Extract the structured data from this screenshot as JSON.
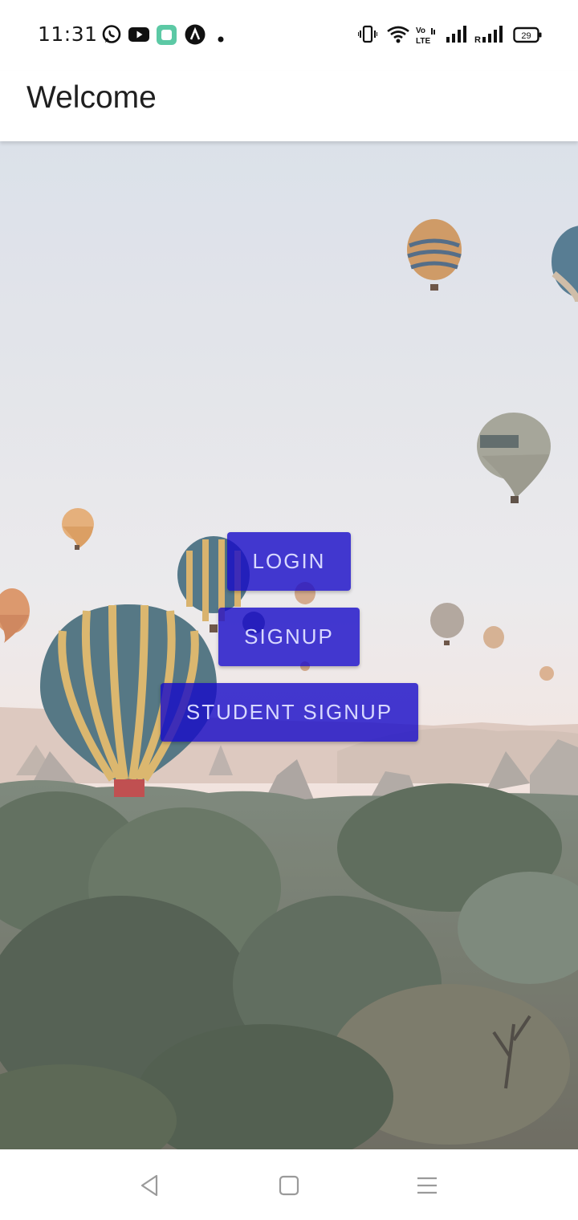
{
  "status_bar": {
    "time": "11:31",
    "left_icons": [
      "whatsapp-icon",
      "youtube-icon",
      "app-icon",
      "arc-icon",
      "dot-icon"
    ],
    "right_icons": [
      "vibrate-icon",
      "wifi-icon",
      "volte-icon",
      "signal-icon",
      "roaming-signal-icon"
    ],
    "roaming_label": "R",
    "volte_label": "Vo LTE",
    "battery": "29"
  },
  "app_bar": {
    "title": "Welcome"
  },
  "buttons": {
    "login": "LOGIN",
    "signup": "SIGNUP",
    "student_signup": "STUDENT SIGNUP"
  },
  "colors": {
    "button": "#1e10c8",
    "button_text": "#d8d8ff"
  },
  "nav_bar": {
    "items": [
      "back-icon",
      "home-icon",
      "menu-icon"
    ]
  }
}
